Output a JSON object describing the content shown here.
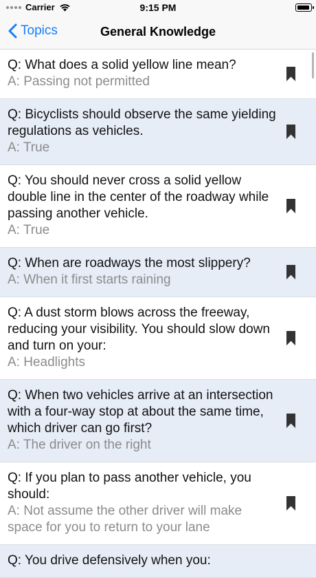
{
  "status_bar": {
    "carrier": "Carrier",
    "time": "9:15 PM"
  },
  "nav": {
    "back_label": "Topics",
    "title": "General Knowledge"
  },
  "items": [
    {
      "q": "Q: What does a solid yellow line mean?",
      "a": "A: Passing not permitted"
    },
    {
      "q": "Q: Bicyclists should observe the same yielding regulations as vehicles.",
      "a": "A: True"
    },
    {
      "q": "Q: You should never cross a solid yellow double line in the center of the roadway while passing another vehicle.",
      "a": "A: True"
    },
    {
      "q": "Q: When are roadways the most slippery?",
      "a": "A: When it first starts raining"
    },
    {
      "q": "Q: A dust storm blows across the freeway, reducing your visibility. You should slow down and turn on your:",
      "a": "A: Headlights"
    },
    {
      "q": "Q: When two vehicles arrive at an intersection with a four-way stop at about the same time, which driver can go first?",
      "a": "A: The driver on the right"
    },
    {
      "q": "Q: If you plan to pass another vehicle, you should:",
      "a": "A: Not assume the other driver will make space for you to return to your lane"
    },
    {
      "q": "Q: You drive defensively when you:",
      "a": ""
    }
  ],
  "colors": {
    "accent": "#147efb",
    "alt_row": "#e6edf7",
    "answer_text": "#8b8b8b"
  },
  "icons": {
    "back": "chevron-left-icon",
    "bookmark": "bookmark-icon",
    "wifi": "wifi-icon",
    "battery": "battery-icon"
  }
}
